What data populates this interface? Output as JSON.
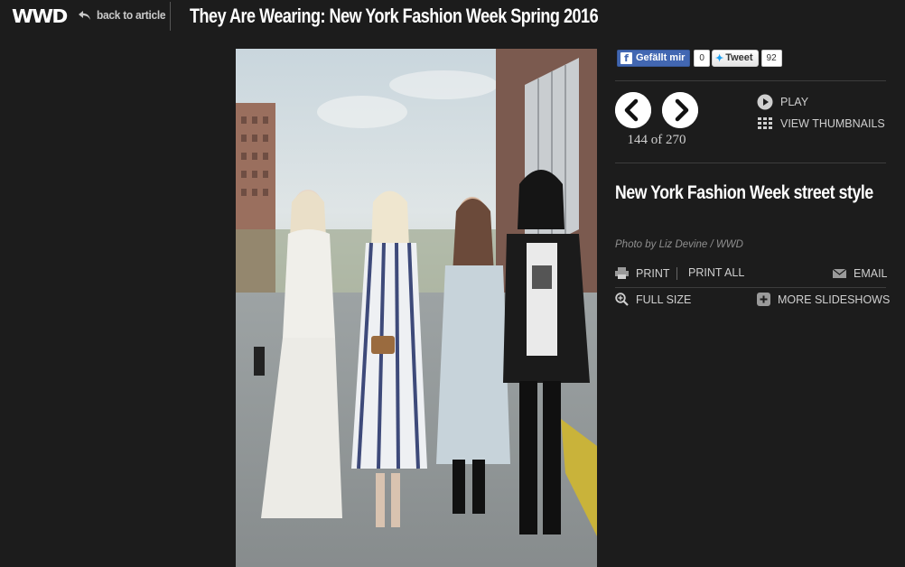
{
  "header": {
    "logo": "WWD",
    "back_label": "back to article",
    "title": "They Are Wearing: New York Fashion Week Spring 2016"
  },
  "social": {
    "like_label": "Gefällt mir",
    "like_count": "0",
    "tweet_label": "Tweet",
    "tweet_count": "92"
  },
  "slideshow": {
    "counter": "144 of 270",
    "play_label": "PLAY",
    "thumbnails_label": "VIEW THUMBNAILS",
    "slide_title": "New York Fashion Week street style",
    "photo_credit": "Photo by Liz Devine / WWD"
  },
  "actions": {
    "print": "PRINT",
    "print_all": "PRINT ALL",
    "email": "EMAIL",
    "full_size": "FULL SIZE",
    "more_slideshows": "MORE SLIDESHOWS"
  },
  "icons": {
    "back": "reply-arrow-icon",
    "prev": "chevron-left-icon",
    "next": "chevron-right-icon",
    "play": "play-icon",
    "thumbnails": "grid-icon",
    "print": "printer-icon",
    "email": "envelope-icon",
    "full_size": "magnifier-plus-icon",
    "more": "plus-icon"
  },
  "colors": {
    "background": "#1c1c1c",
    "facebook": "#4267b2",
    "twitter": "#1da1f2",
    "text": "#cfcfcf"
  }
}
